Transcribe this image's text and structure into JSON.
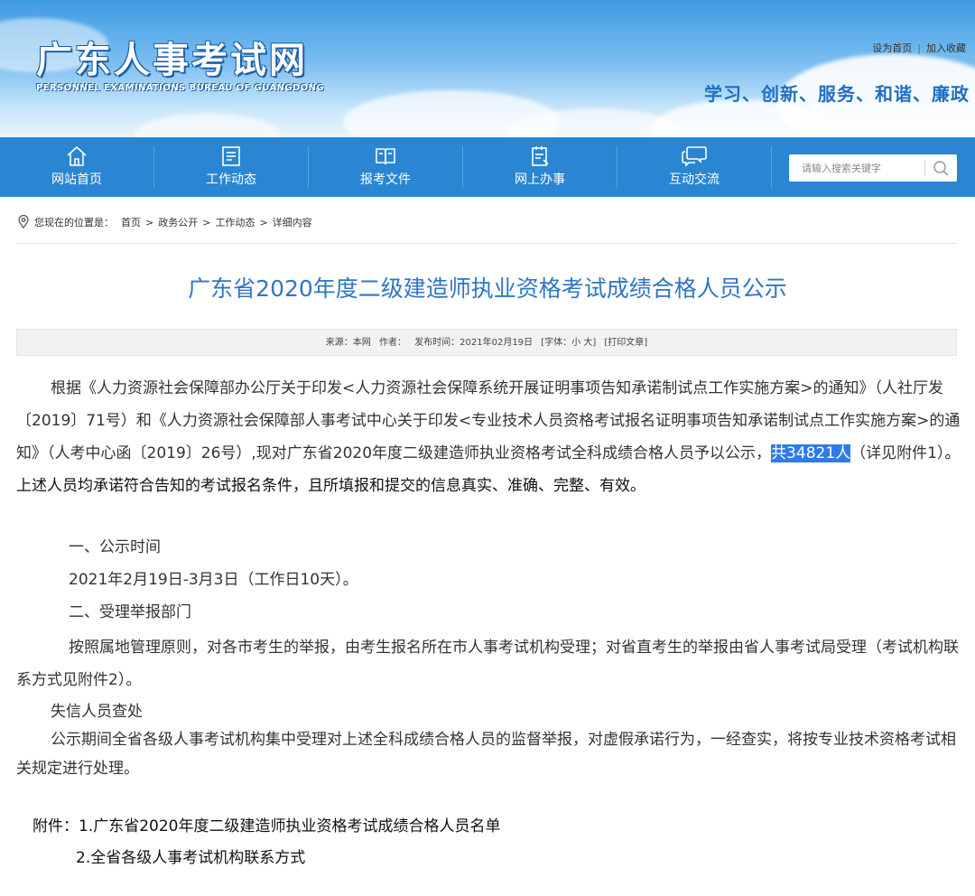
{
  "header": {
    "logo_cn": "广东人事考试网",
    "logo_en": "PERSONNEL EXAMINATIONS BUREAU OF GUANGDONG",
    "set_home": "设为首页",
    "separator": "|",
    "add_favorite": "加入收藏",
    "slogan": "学习、创新、服务、和谐、廉政"
  },
  "nav": {
    "items": [
      {
        "label": "网站首页",
        "icon": "home-icon"
      },
      {
        "label": "工作动态",
        "icon": "news-icon"
      },
      {
        "label": "报考文件",
        "icon": "book-icon"
      },
      {
        "label": "网上办事",
        "icon": "clipboard-icon"
      },
      {
        "label": "互动交流",
        "icon": "chat-icon"
      }
    ],
    "search_placeholder": "请输入搜索关键字"
  },
  "breadcrumb": {
    "prefix": "您现在的位置是：",
    "items": [
      "首页",
      "政务公开",
      "工作动态",
      "详细内容"
    ],
    "arrow": ">"
  },
  "article": {
    "title": "广东省2020年度二级建造师执业资格考试成绩合格人员公示",
    "meta": {
      "source": "来源：本网",
      "author": "作者：",
      "published": "发布时间：2021年02月19日",
      "font_size": "[字体：小 大]",
      "print": "[打印文章]"
    },
    "para1_a": "根据《人力资源社会保障部办公厅关于印发<人力资源社会保障系统开展证明事项告知承诺制试点工作实施方案>的通知》（人社厅发〔2019〕71号）和《人力资源社会保障部人事考试中心关于印发<专业技术人员资格考试报名证明事项告知承诺制试点工作实施方案>的通知》（人考中心函〔2019〕26号）,现对广东省2020年度二级建造师执业资格考试全科成绩合格人员予以公示，",
    "para1_highlight": "共34821人",
    "para1_b": "（详见附件1）",
    "para1_c": "。上述人员均承诺符合告知的考试报名条件，且所填报和提交的信息真实、准确、完整、有效。",
    "section1_title": "一、公示时间",
    "section1_text": "2021年2月19日-3月3日（工作日10天）。",
    "section2_title": "二、受理举报部门",
    "section2_text": "按照属地管理原则，对各市考生的举报，由考生报名所在市人事考试机构受理；对省直考生的举报由省人事考试局受理（考试机构联系方式见附件2）。",
    "section3_title": "失信人员查处",
    "section3_text": "公示期间全省各级人事考试机构集中受理对上述全科成绩合格人员的监督举报，对虚假承诺行为，一经查实，将按专业技术资格考试相关规定进行处理。",
    "attachment_label": "附件：",
    "attachment_1": "1.广东省2020年度二级建造师执业资格考试成绩合格人员名单",
    "attachment_2": "2.全省各级人事考试机构联系方式"
  },
  "colors": {
    "nav_bg": "#2a86d2",
    "title": "#2f76c2",
    "highlight": "#2f7be8"
  }
}
